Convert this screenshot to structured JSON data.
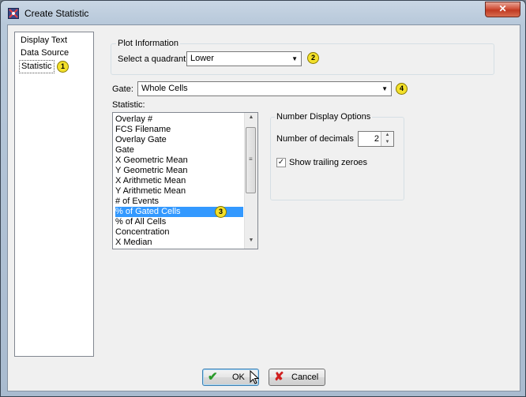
{
  "window": {
    "title": "Create Statistic",
    "close_label": "✕"
  },
  "nav": {
    "items": [
      "Display Text",
      "Data Source",
      "Statistic"
    ],
    "selected_index": 2,
    "badge": "1"
  },
  "plot_info": {
    "group_label": "Plot Information",
    "quadrant_label": "Select a quadrant",
    "quadrant_value": "Lower",
    "badge": "2"
  },
  "gate": {
    "label": "Gate:",
    "value": "Whole Cells",
    "badge": "4"
  },
  "statistic": {
    "label": "Statistic:",
    "items": [
      "Overlay #",
      "FCS Filename",
      "Overlay Gate",
      "Gate",
      "X Geometric Mean",
      "Y Geometric Mean",
      "X Arithmetic Mean",
      "Y Arithmetic Mean",
      "# of Events",
      "% of Gated Cells",
      "% of All Cells",
      "Concentration",
      "X Median"
    ],
    "selected_index": 9,
    "badge": "3"
  },
  "number_display": {
    "group_label": "Number Display Options",
    "decimals_label": "Number of decimals",
    "decimals_value": "2",
    "trailing_zeroes_label": "Show trailing zeroes",
    "trailing_zeroes_checked": true
  },
  "buttons": {
    "ok_label": "OK",
    "cancel_label": "Cancel"
  },
  "colors": {
    "selection": "#3399ff",
    "badge": "#f3e02a",
    "ok_icon": "#2a9a2a",
    "cancel_icon": "#d02020"
  }
}
